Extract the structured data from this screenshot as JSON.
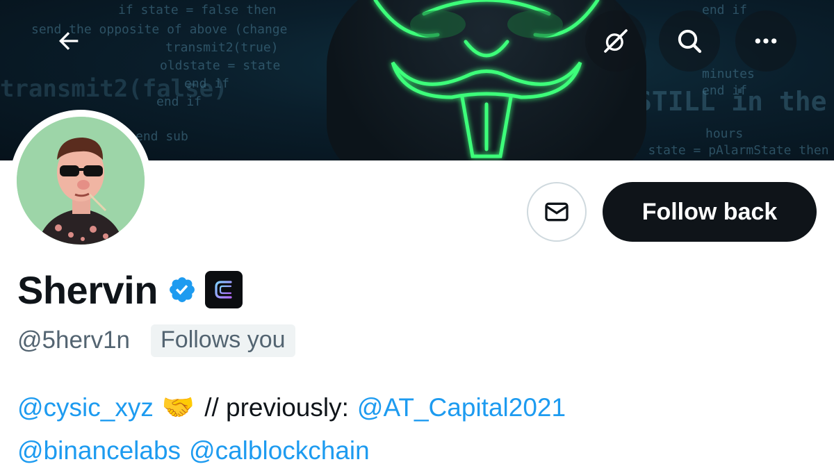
{
  "header": {
    "back_icon": "arrow-left-icon",
    "action_icons": [
      "grok-icon",
      "search-icon",
      "more-icon"
    ]
  },
  "banner": {
    "code_lines": [
      "if state = false then",
      "send the opposite of above (change",
      "transmit2(true)",
      "oldstate = state",
      "end if",
      "end if",
      "transmit2(false)",
      "end sub",
      "end if",
      "minutes",
      "STILL in the",
      "hours",
      "if state = pAlarmState then",
      "end if"
    ]
  },
  "profile": {
    "display_name": "Shervin",
    "handle": "@5herv1n",
    "follows_you": "Follows you",
    "verified": true
  },
  "actions": {
    "message_icon": "envelope-icon",
    "follow_label": "Follow back"
  },
  "bio": {
    "line1": {
      "mention1": "@cysic_xyz",
      "emoji": "🤝",
      "text": "// previously:",
      "mention2": "@AT_Capital2021"
    },
    "line2": {
      "mention1": "@binancelabs",
      "mention2": "@calblockchain"
    }
  },
  "colors": {
    "accent": "#1d9bf0",
    "text_primary": "#0f1419",
    "text_secondary": "#536471",
    "button_dark": "#0f1419"
  }
}
